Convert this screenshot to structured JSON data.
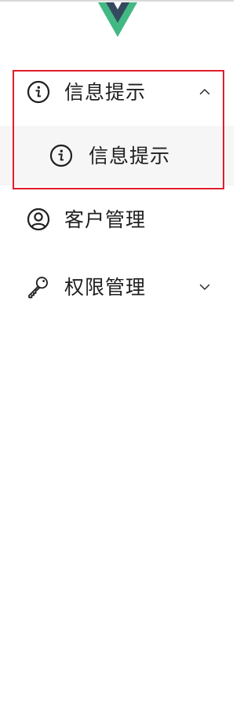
{
  "app": {
    "logo": "vue-logo",
    "colors": {
      "vue_green": "#42b883",
      "vue_dark": "#35495e",
      "text": "#1f1f1f",
      "submenu_bg": "#f6f6f6",
      "highlight": "#e01e2b"
    }
  },
  "menu": {
    "items": [
      {
        "label": "信息提示",
        "icon": "info-icon",
        "expanded": true,
        "children": [
          {
            "label": "信息提示",
            "icon": "info-icon"
          }
        ]
      },
      {
        "label": "客户管理",
        "icon": "user-circle-icon"
      },
      {
        "label": "权限管理",
        "icon": "key-icon",
        "expanded": false
      }
    ]
  }
}
